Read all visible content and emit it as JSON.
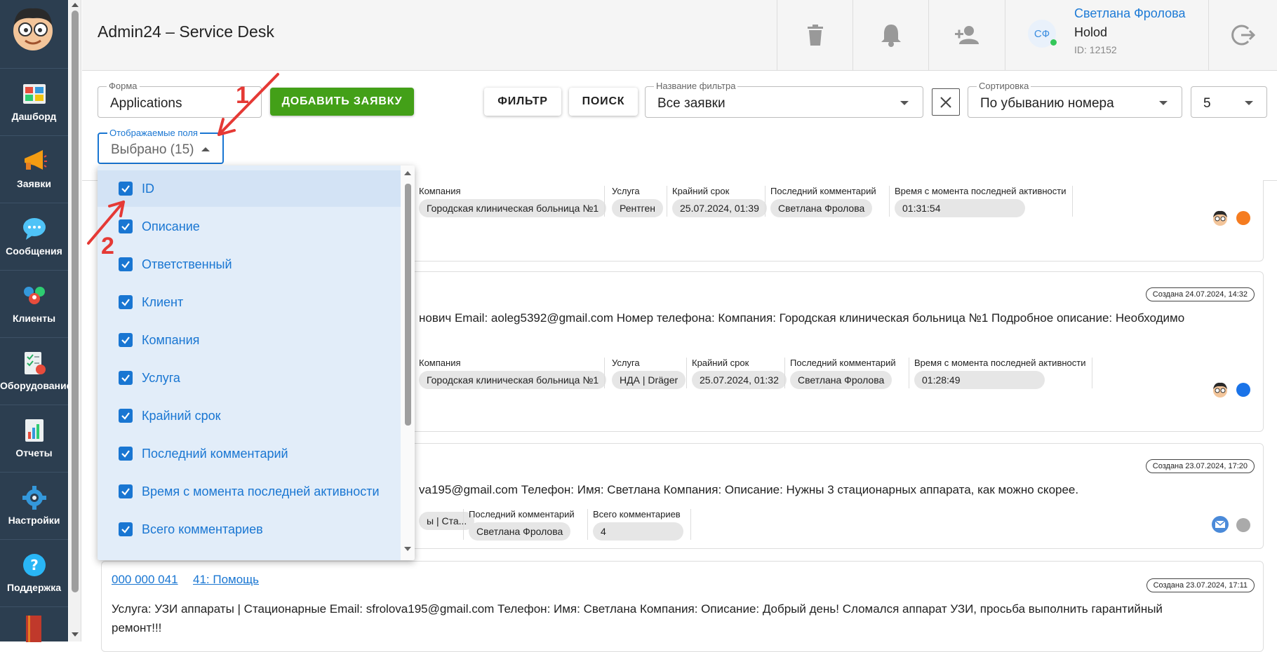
{
  "nav": {
    "items": [
      {
        "label": "Дашборд",
        "icon": "dashboard-icon"
      },
      {
        "label": "Заявки",
        "icon": "megaphone-icon"
      },
      {
        "label": "Сообщения",
        "icon": "chat-icon"
      },
      {
        "label": "Клиенты",
        "icon": "clients-icon"
      },
      {
        "label": "Оборудование",
        "icon": "equipment-icon"
      },
      {
        "label": "Отчеты",
        "icon": "reports-icon"
      },
      {
        "label": "Настройки",
        "icon": "gear-icon"
      },
      {
        "label": "Поддержка",
        "icon": "help-icon"
      }
    ]
  },
  "header": {
    "title": "Admin24 – Service Desk",
    "user": {
      "initials": "СФ",
      "name": "Светлана Фролова",
      "company": "Holod",
      "id": "ID: 12152"
    }
  },
  "toolbar": {
    "form_label": "Форма",
    "form_value": "Applications",
    "add_button": "ДОБАВИТЬ ЗАЯВКУ",
    "filter_button": "ФИЛЬТР",
    "search_button": "ПОИСК",
    "filter_name_label": "Название фильтра",
    "filter_name_value": "Все заявки",
    "sort_label": "Сортировка",
    "sort_value": "По убыванию номера",
    "page_size": "5",
    "fields_label": "Отображаемые поля",
    "fields_value": "Выбрано (15)"
  },
  "fields_options": [
    "ID",
    "Описание",
    "Ответственный",
    "Клиент",
    "Компания",
    "Услуга",
    "Крайний срок",
    "Последний комментарий",
    "Время с момента последней активности",
    "Всего комментариев"
  ],
  "cards": [
    {
      "chips": [
        {
          "label": "Компания",
          "value": "Городская клиническая больница №1"
        },
        {
          "label": "Услуга",
          "value": "Рентген"
        },
        {
          "label": "Крайний срок",
          "value": "25.07.2024, 01:39"
        },
        {
          "label": "Последний комментарий",
          "value": "Светлана Фролова"
        },
        {
          "label": "Время с момента последней активности",
          "value": "01:31:54"
        }
      ]
    },
    {
      "created": "Создана 24.07.2024, 14:32",
      "description": "нович Email: aoleg5392@gmail.com Номер телефона: Компания: Городская клиническая больница №1 Подробное описание: Необходимо",
      "chips": [
        {
          "label": "Компания",
          "value": "Городская клиническая больница №1"
        },
        {
          "label": "Услуга",
          "value": "НДА | Dräger"
        },
        {
          "label": "Крайний срок",
          "value": "25.07.2024, 01:32"
        },
        {
          "label": "Последний комментарий",
          "value": "Светлана Фролова"
        },
        {
          "label": "Время с момента последней активности",
          "value": "01:28:49"
        }
      ]
    },
    {
      "created": "Создана 23.07.2024, 17:20",
      "description": "va195@gmail.com Телефон: Имя: Светлана Компания: Описание: Нужны 3 стационарных аппарата, как можно скорее.",
      "chips": [
        {
          "label": "",
          "value": "ы | Ста..."
        },
        {
          "label": "Последний комментарий",
          "value": "Светлана Фролова"
        },
        {
          "label": "Всего комментариев",
          "value": "4"
        }
      ]
    },
    {
      "created": "Создана 23.07.2024, 17:11",
      "id_link": "000 000 041",
      "title_link": "41: Помощь",
      "description_line1": "Услуга: УЗИ аппараты | Стационарные Email: sfrolova195@gmail.com Телефон: Имя: Светлана Компания: Описание: Добрый день! Сломался аппарат УЗИ, просьба выполнить гарантийный",
      "description_line2": "ремонт!!!"
    }
  ],
  "annotations": {
    "step1": "1",
    "step2": "2"
  },
  "colors": {
    "nav_bg": "#2c3e50",
    "accent": "#1976d2",
    "add_green": "#43a018",
    "status_orange": "#f57c20",
    "status_blue": "#1a73e8",
    "status_grey": "#aaaaaa",
    "annotation_red": "#e53935"
  }
}
